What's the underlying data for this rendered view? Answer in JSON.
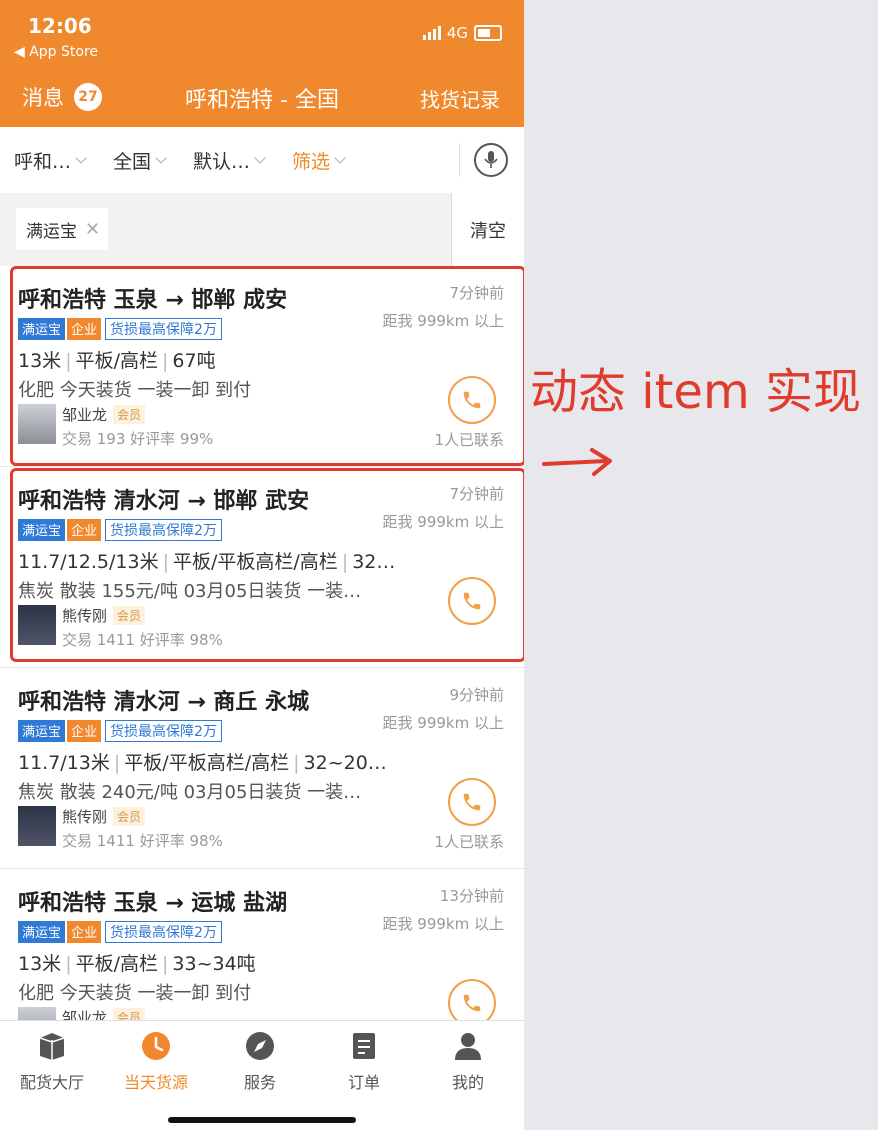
{
  "status": {
    "time": "12:06",
    "back": "App Store",
    "network": "4G"
  },
  "nav": {
    "messages_label": "消息",
    "messages_count": "27",
    "title": "呼和浩特 - 全国",
    "right": "找货记录"
  },
  "filters": {
    "from": "呼和…",
    "to": "全国",
    "sort": "默认…",
    "filter": "筛选"
  },
  "tag_chip": "满运宝",
  "clear_label": "清空",
  "badges": {
    "ymb": "满运宝",
    "enterprise": "企业",
    "insurance": "货损最高保障2万",
    "member": "会员"
  },
  "listings": [
    {
      "route": "呼和浩特 玉泉 → 邯郸 成安",
      "time_ago": "7分钟前",
      "distance": "距我 999km 以上",
      "length": "13米",
      "truck": "平板/高栏",
      "weight": "67吨",
      "cargo": "化肥  今天装货  一装一卸  到付",
      "user": "邹业龙",
      "trade": "交易 193  好评率 99%",
      "contacted": "1人已联系"
    },
    {
      "route": "呼和浩特 清水河 → 邯郸 武安",
      "time_ago": "7分钟前",
      "distance": "距我 999km 以上",
      "length": "11.7/12.5/13米",
      "truck": "平板/平板高栏/高栏",
      "weight": "32…",
      "cargo": "焦炭  散装  155元/吨  03月05日装货  一装…",
      "user": "熊传刚",
      "trade": "交易 1411  好评率 98%",
      "contacted": ""
    },
    {
      "route": "呼和浩特 清水河 → 商丘 永城",
      "time_ago": "9分钟前",
      "distance": "距我 999km 以上",
      "length": "11.7/13米",
      "truck": "平板/平板高栏/高栏",
      "weight": "32~20…",
      "cargo": "焦炭  散装  240元/吨  03月05日装货  一装…",
      "user": "熊传刚",
      "trade": "交易 1411  好评率 98%",
      "contacted": "1人已联系"
    },
    {
      "route": "呼和浩特 玉泉 → 运城 盐湖",
      "time_ago": "13分钟前",
      "distance": "距我 999km 以上",
      "length": "13米",
      "truck": "平板/高栏",
      "weight": "33~34吨",
      "cargo": "化肥  今天装货  一装一卸  到付",
      "user": "邹业龙",
      "trade": "",
      "contacted": ""
    }
  ],
  "tabs": [
    {
      "label": "配货大厅",
      "icon": "box-icon"
    },
    {
      "label": "当天货源",
      "icon": "clock-icon"
    },
    {
      "label": "服务",
      "icon": "compass-icon"
    },
    {
      "label": "订单",
      "icon": "document-icon"
    },
    {
      "label": "我的",
      "icon": "person-icon"
    }
  ],
  "annotation": "动态 item 实现",
  "colors": {
    "brand_orange": "#f0892e",
    "annotation_red": "#e03b2d",
    "badge_blue": "#2f7ad6"
  }
}
